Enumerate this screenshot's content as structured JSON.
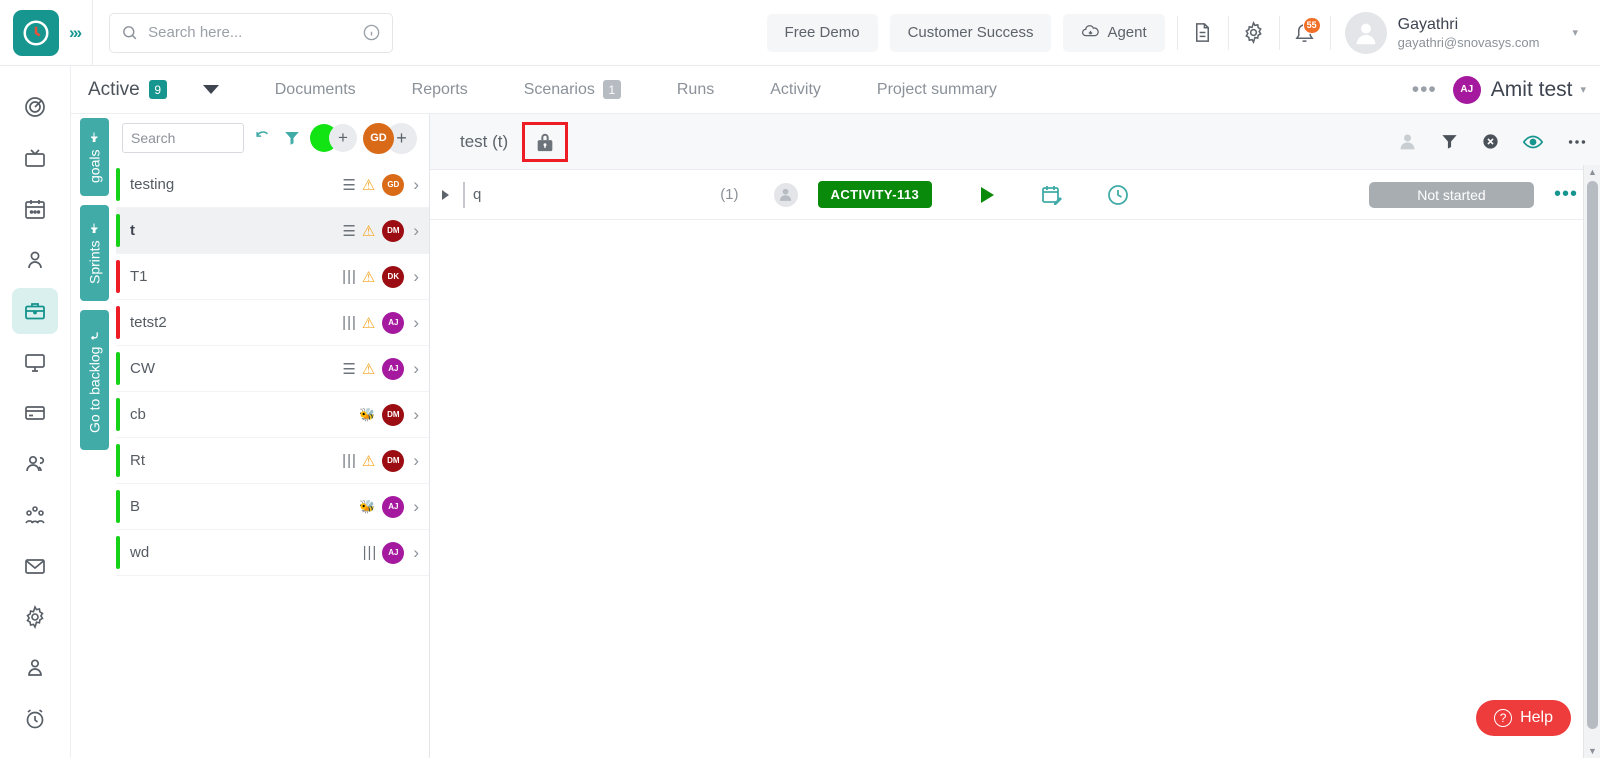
{
  "header": {
    "logo_icon": "clock-logo-icon",
    "expand_icon": "chevron-triple-right-icon",
    "search": {
      "placeholder": "Search here...",
      "value": "",
      "icon": "search-icon",
      "info_icon": "info-icon"
    },
    "buttons": [
      {
        "label": "Free Demo",
        "name": "free-demo-button"
      },
      {
        "label": "Customer Success",
        "name": "customer-success-button"
      },
      {
        "label": "Agent",
        "name": "agent-button",
        "icon": "cloud-download-icon"
      }
    ],
    "icons": [
      {
        "name": "document-icon"
      },
      {
        "name": "gear-icon"
      },
      {
        "name": "bell-icon"
      }
    ],
    "notification_count": "55",
    "user": {
      "name": "Gayathri",
      "email": "gayathri@snovasys.com",
      "avatar_icon": "user-avatar-icon",
      "caret": "▾"
    }
  },
  "rail": [
    {
      "name": "sidebar-item-target",
      "icon": "target-icon",
      "active": false
    },
    {
      "name": "sidebar-item-tv",
      "icon": "tv-icon",
      "active": false
    },
    {
      "name": "sidebar-item-calendar",
      "icon": "calendar-icon",
      "active": false
    },
    {
      "name": "sidebar-item-person",
      "icon": "person-icon",
      "active": false
    },
    {
      "name": "sidebar-item-projects",
      "icon": "briefcase-icon",
      "active": true
    },
    {
      "name": "sidebar-item-monitor",
      "icon": "monitor-icon",
      "active": false
    },
    {
      "name": "sidebar-item-billing",
      "icon": "credit-card-icon",
      "active": false
    },
    {
      "name": "sidebar-item-users",
      "icon": "users-icon",
      "active": false
    },
    {
      "name": "sidebar-item-teams",
      "icon": "team-icon",
      "active": false
    },
    {
      "name": "sidebar-item-mail",
      "icon": "envelope-icon",
      "active": false
    },
    {
      "name": "sidebar-item-settings",
      "icon": "gear-icon",
      "active": false
    },
    {
      "name": "sidebar-item-profile",
      "icon": "user-badge-icon",
      "active": false
    },
    {
      "name": "sidebar-item-timer",
      "icon": "alarm-clock-icon",
      "active": false
    }
  ],
  "tabs": {
    "active_label": "Active",
    "active_count": "9",
    "dropdown_icon": "triangle-down-icon",
    "items": [
      {
        "label": "Documents",
        "name": "tab-documents",
        "count": ""
      },
      {
        "label": "Reports",
        "name": "tab-reports",
        "count": ""
      },
      {
        "label": "Scenarios",
        "name": "tab-scenarios",
        "count": "1"
      },
      {
        "label": "Runs",
        "name": "tab-runs",
        "count": ""
      },
      {
        "label": "Activity",
        "name": "tab-activity",
        "count": ""
      },
      {
        "label": "Project summary",
        "name": "tab-project-summary",
        "count": ""
      }
    ],
    "more_icon": "•••",
    "project": {
      "initials": "AJ",
      "name": "Amit test",
      "caret": "▾"
    }
  },
  "vtabs": [
    {
      "label": "goals",
      "name": "vtab-goals",
      "icon": "pin-icon"
    },
    {
      "label": "Sprints",
      "name": "vtab-sprints",
      "icon": "pin-icon"
    },
    {
      "label": "Go to backlog",
      "name": "vtab-go-to-backlog",
      "icon": "arrow-up-icon"
    }
  ],
  "list": {
    "search_placeholder": "Search",
    "search_value": "",
    "refresh_icon": "refresh-icon",
    "filter_icon": "filter-icon",
    "status_dot_color": "#12e312",
    "add_icon": "plus-icon",
    "owner_initials": "GD",
    "add_member_icon": "plus-icon",
    "items": [
      {
        "name": "testing",
        "bar": "#16d216",
        "priority": "☰",
        "warn": true,
        "bug": false,
        "avatar": "GD",
        "avatar_color": "#d96a18",
        "selected": false
      },
      {
        "name": "t",
        "bar": "#16d216",
        "priority": "☰",
        "warn": true,
        "bug": false,
        "avatar": "DM",
        "avatar_color": "#9b0d12",
        "selected": true
      },
      {
        "name": "T1",
        "bar": "#ee1c25",
        "priority": "|||",
        "warn": true,
        "bug": false,
        "avatar": "DK",
        "avatar_color": "#9b0d12",
        "selected": false
      },
      {
        "name": "tetst2",
        "bar": "#ee1c25",
        "priority": "|||",
        "warn": true,
        "bug": false,
        "avatar": "AJ",
        "avatar_color": "#a5199f",
        "selected": false
      },
      {
        "name": "CW",
        "bar": "#16d216",
        "priority": "☰",
        "warn": true,
        "bug": false,
        "avatar": "AJ",
        "avatar_color": "#a5199f",
        "selected": false
      },
      {
        "name": "cb",
        "bar": "#16d216",
        "priority": "",
        "warn": false,
        "bug": true,
        "avatar": "DM",
        "avatar_color": "#9b0d12",
        "selected": false
      },
      {
        "name": "Rt",
        "bar": "#16d216",
        "priority": "|||",
        "warn": true,
        "bug": false,
        "avatar": "DM",
        "avatar_color": "#9b0d12",
        "selected": false
      },
      {
        "name": "B",
        "bar": "#16d216",
        "priority": "",
        "warn": false,
        "bug": true,
        "avatar": "AJ",
        "avatar_color": "#a5199f",
        "selected": false
      },
      {
        "name": "wd",
        "bar": "#16d216",
        "priority": "|||",
        "warn": false,
        "bug": false,
        "avatar": "AJ",
        "avatar_color": "#a5199f",
        "selected": false
      }
    ]
  },
  "content": {
    "title": "test (t)",
    "lock_icon": "lock-icon",
    "highlight_color": "#ee1c25",
    "toolbar_icons": [
      {
        "name": "assignee-avatar-icon"
      },
      {
        "name": "filter-icon"
      },
      {
        "name": "clear-filter-icon"
      },
      {
        "name": "eye-icon"
      },
      {
        "name": "more-options-icon"
      }
    ],
    "row": {
      "expand_icon": "expand-triangle-icon",
      "name": "q",
      "count": "(1)",
      "assignee_icon": "user-avatar-icon",
      "badge": "ACTIVITY-113",
      "badge_color": "#0a8a0a",
      "play_icon": "play-icon",
      "calendar_icon": "calendar-edit-icon",
      "clock_icon": "clock-icon",
      "status": "Not started",
      "more_icon": "•••"
    }
  },
  "help": {
    "label": "Help",
    "icon": "question-icon"
  }
}
